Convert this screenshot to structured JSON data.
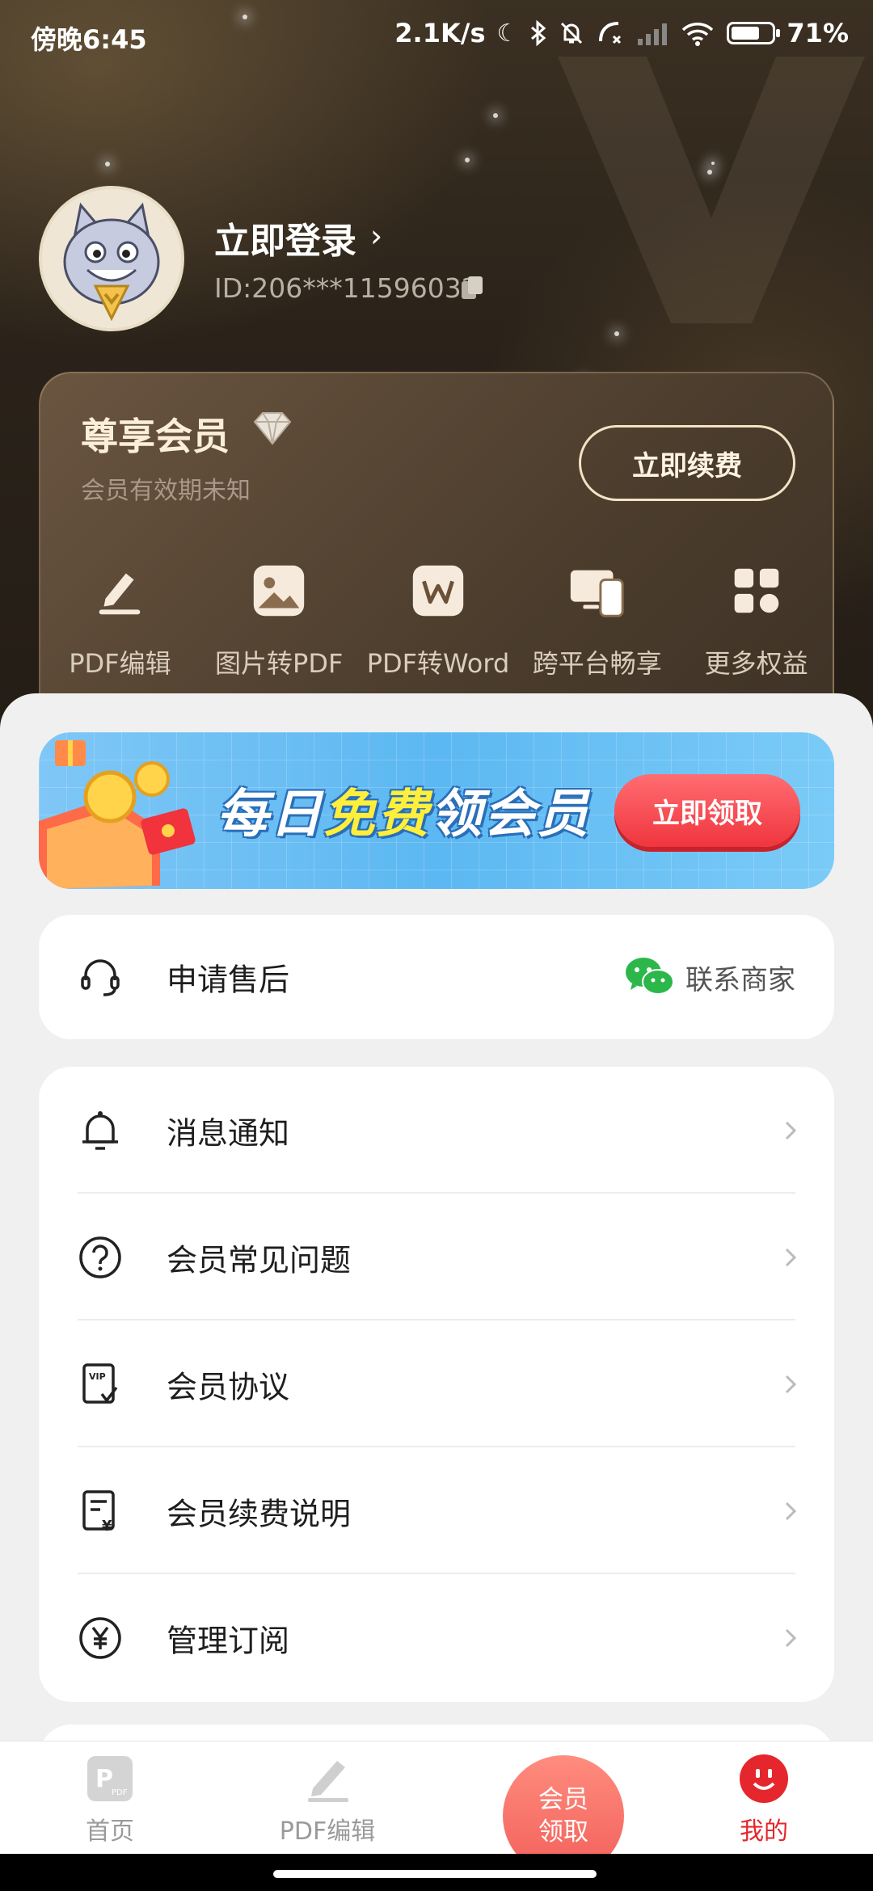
{
  "status_bar": {
    "time": "傍晚6:45",
    "network_speed": "2.1K/s",
    "battery": "71%",
    "battery_level": 0.71,
    "icons": [
      "moon-icon",
      "bluetooth-icon",
      "mute-bell-icon",
      "call-icon",
      "signal-icon",
      "wifi-icon",
      "battery-icon"
    ]
  },
  "profile": {
    "login_label": "立即登录",
    "user_id": "ID:206***11596032",
    "avatar_icon": "cat-avatar-icon"
  },
  "vip": {
    "title": "尊享会员",
    "validity": "会员有效期未知",
    "renew_label": "立即续费",
    "benefits": [
      {
        "label": "PDF编辑",
        "icon": "pencil-icon"
      },
      {
        "label": "图片转PDF",
        "icon": "image-icon"
      },
      {
        "label": "PDF转Word",
        "icon": "word-icon"
      },
      {
        "label": "跨平台畅享",
        "icon": "devices-icon"
      },
      {
        "label": "更多权益",
        "icon": "grid-icon"
      }
    ]
  },
  "banner": {
    "title_part1": "每日",
    "title_highlight": "免费",
    "title_part2": "领会员",
    "button_label": "立即领取"
  },
  "aftersale": {
    "label": "申请售后",
    "contact_label": "联系商家"
  },
  "menu": [
    {
      "label": "消息通知",
      "icon": "bell-icon"
    },
    {
      "label": "会员常见问题",
      "icon": "question-icon"
    },
    {
      "label": "会员协议",
      "icon": "vip-document-icon"
    },
    {
      "label": "会员续费说明",
      "icon": "renewal-document-icon"
    },
    {
      "label": "管理订阅",
      "icon": "yen-circle-icon"
    }
  ],
  "bottom_nav": {
    "home": "首页",
    "pdf_edit": "PDF编辑",
    "center_line1": "会员",
    "center_line2": "领取",
    "mine": "我的"
  },
  "colors": {
    "accent_red": "#e5262c",
    "gold_text": "#fbefd9",
    "header_dark": "#2b231a",
    "banner_blue": "#5cb8f2"
  }
}
